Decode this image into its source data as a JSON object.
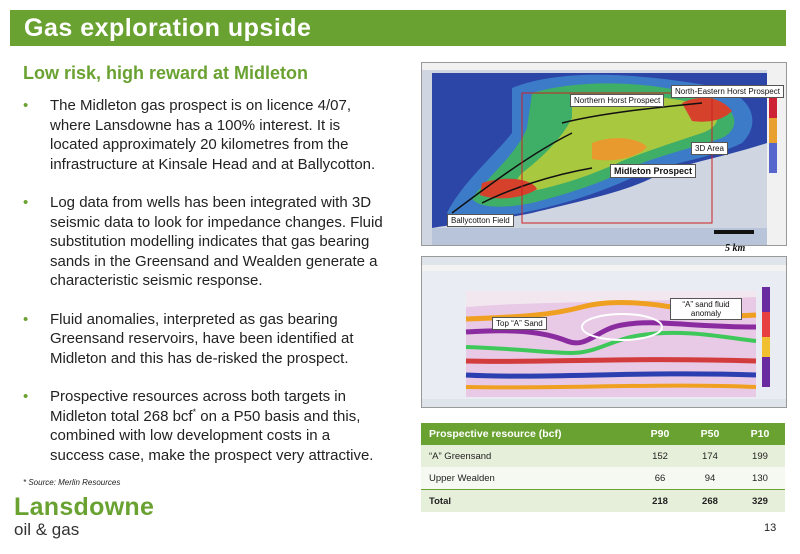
{
  "header": {
    "title": "Gas exploration upside"
  },
  "subtitle": "Low risk, high reward at Midleton",
  "bullets": [
    {
      "text": "The Midleton gas prospect is on licence 4/07, where Lansdowne has a 100% interest. It is located approximately 20 kilometres from the infrastructure at Kinsale Head and at Ballycotton."
    },
    {
      "text": "Log data from wells has been integrated with 3D seismic data to look for impedance changes. Fluid substitution modelling indicates that gas bearing sands in the Greensand and Wealden  generate a characteristic seismic response."
    },
    {
      "text": "Fluid anomalies, interpreted as gas bearing Greensand reservoirs, have been identified at Midleton and this has de-risked the prospect."
    },
    {
      "text_before": "Prospective resources across both targets in Midleton total 268 bcf",
      "sup": "*",
      "text_after": " on a P50 basis and this, combined with low development costs in a success case, make the prospect very attractive."
    }
  ],
  "source_note": "* Source: Merlin Resources",
  "map": {
    "labels": {
      "northern_horst": "Northern Horst Prospect",
      "north_eastern_horst": "North-Eastern Horst Prospect",
      "area_3d": "3D Area",
      "midleton": "Midleton Prospect",
      "ballycotton": "Ballycotton Field"
    },
    "scale": "5 km"
  },
  "seismic": {
    "labels": {
      "top_a_sand": "Top “A” Sand",
      "a_sand_anomaly": "“A” sand fluid anomaly"
    }
  },
  "table": {
    "headers": [
      "Prospective resource (bcf)",
      "P90",
      "P50",
      "P10"
    ],
    "rows": [
      [
        "“A” Greensand",
        "152",
        "174",
        "199"
      ],
      [
        "Upper Wealden",
        "66",
        "94",
        "130"
      ],
      [
        "Total",
        "218",
        "268",
        "329"
      ]
    ]
  },
  "logo": {
    "name": "Lansdowne",
    "sub": "oil & gas"
  },
  "page_number": "13",
  "colors": {
    "brand_green": "#6aa232",
    "table_alt": "#e6efd9"
  }
}
